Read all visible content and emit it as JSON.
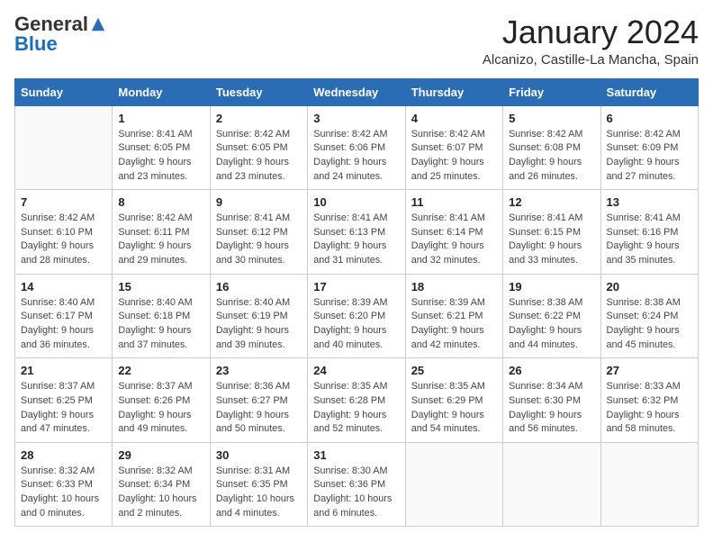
{
  "logo": {
    "general": "General",
    "blue": "Blue"
  },
  "title": "January 2024",
  "location": "Alcanizo, Castille-La Mancha, Spain",
  "days_of_week": [
    "Sunday",
    "Monday",
    "Tuesday",
    "Wednesday",
    "Thursday",
    "Friday",
    "Saturday"
  ],
  "weeks": [
    [
      {
        "day": "",
        "info": ""
      },
      {
        "day": "1",
        "info": "Sunrise: 8:41 AM\nSunset: 6:05 PM\nDaylight: 9 hours\nand 23 minutes."
      },
      {
        "day": "2",
        "info": "Sunrise: 8:42 AM\nSunset: 6:05 PM\nDaylight: 9 hours\nand 23 minutes."
      },
      {
        "day": "3",
        "info": "Sunrise: 8:42 AM\nSunset: 6:06 PM\nDaylight: 9 hours\nand 24 minutes."
      },
      {
        "day": "4",
        "info": "Sunrise: 8:42 AM\nSunset: 6:07 PM\nDaylight: 9 hours\nand 25 minutes."
      },
      {
        "day": "5",
        "info": "Sunrise: 8:42 AM\nSunset: 6:08 PM\nDaylight: 9 hours\nand 26 minutes."
      },
      {
        "day": "6",
        "info": "Sunrise: 8:42 AM\nSunset: 6:09 PM\nDaylight: 9 hours\nand 27 minutes."
      }
    ],
    [
      {
        "day": "7",
        "info": "Sunrise: 8:42 AM\nSunset: 6:10 PM\nDaylight: 9 hours\nand 28 minutes."
      },
      {
        "day": "8",
        "info": "Sunrise: 8:42 AM\nSunset: 6:11 PM\nDaylight: 9 hours\nand 29 minutes."
      },
      {
        "day": "9",
        "info": "Sunrise: 8:41 AM\nSunset: 6:12 PM\nDaylight: 9 hours\nand 30 minutes."
      },
      {
        "day": "10",
        "info": "Sunrise: 8:41 AM\nSunset: 6:13 PM\nDaylight: 9 hours\nand 31 minutes."
      },
      {
        "day": "11",
        "info": "Sunrise: 8:41 AM\nSunset: 6:14 PM\nDaylight: 9 hours\nand 32 minutes."
      },
      {
        "day": "12",
        "info": "Sunrise: 8:41 AM\nSunset: 6:15 PM\nDaylight: 9 hours\nand 33 minutes."
      },
      {
        "day": "13",
        "info": "Sunrise: 8:41 AM\nSunset: 6:16 PM\nDaylight: 9 hours\nand 35 minutes."
      }
    ],
    [
      {
        "day": "14",
        "info": "Sunrise: 8:40 AM\nSunset: 6:17 PM\nDaylight: 9 hours\nand 36 minutes."
      },
      {
        "day": "15",
        "info": "Sunrise: 8:40 AM\nSunset: 6:18 PM\nDaylight: 9 hours\nand 37 minutes."
      },
      {
        "day": "16",
        "info": "Sunrise: 8:40 AM\nSunset: 6:19 PM\nDaylight: 9 hours\nand 39 minutes."
      },
      {
        "day": "17",
        "info": "Sunrise: 8:39 AM\nSunset: 6:20 PM\nDaylight: 9 hours\nand 40 minutes."
      },
      {
        "day": "18",
        "info": "Sunrise: 8:39 AM\nSunset: 6:21 PM\nDaylight: 9 hours\nand 42 minutes."
      },
      {
        "day": "19",
        "info": "Sunrise: 8:38 AM\nSunset: 6:22 PM\nDaylight: 9 hours\nand 44 minutes."
      },
      {
        "day": "20",
        "info": "Sunrise: 8:38 AM\nSunset: 6:24 PM\nDaylight: 9 hours\nand 45 minutes."
      }
    ],
    [
      {
        "day": "21",
        "info": "Sunrise: 8:37 AM\nSunset: 6:25 PM\nDaylight: 9 hours\nand 47 minutes."
      },
      {
        "day": "22",
        "info": "Sunrise: 8:37 AM\nSunset: 6:26 PM\nDaylight: 9 hours\nand 49 minutes."
      },
      {
        "day": "23",
        "info": "Sunrise: 8:36 AM\nSunset: 6:27 PM\nDaylight: 9 hours\nand 50 minutes."
      },
      {
        "day": "24",
        "info": "Sunrise: 8:35 AM\nSunset: 6:28 PM\nDaylight: 9 hours\nand 52 minutes."
      },
      {
        "day": "25",
        "info": "Sunrise: 8:35 AM\nSunset: 6:29 PM\nDaylight: 9 hours\nand 54 minutes."
      },
      {
        "day": "26",
        "info": "Sunrise: 8:34 AM\nSunset: 6:30 PM\nDaylight: 9 hours\nand 56 minutes."
      },
      {
        "day": "27",
        "info": "Sunrise: 8:33 AM\nSunset: 6:32 PM\nDaylight: 9 hours\nand 58 minutes."
      }
    ],
    [
      {
        "day": "28",
        "info": "Sunrise: 8:32 AM\nSunset: 6:33 PM\nDaylight: 10 hours\nand 0 minutes."
      },
      {
        "day": "29",
        "info": "Sunrise: 8:32 AM\nSunset: 6:34 PM\nDaylight: 10 hours\nand 2 minutes."
      },
      {
        "day": "30",
        "info": "Sunrise: 8:31 AM\nSunset: 6:35 PM\nDaylight: 10 hours\nand 4 minutes."
      },
      {
        "day": "31",
        "info": "Sunrise: 8:30 AM\nSunset: 6:36 PM\nDaylight: 10 hours\nand 6 minutes."
      },
      {
        "day": "",
        "info": ""
      },
      {
        "day": "",
        "info": ""
      },
      {
        "day": "",
        "info": ""
      }
    ]
  ]
}
